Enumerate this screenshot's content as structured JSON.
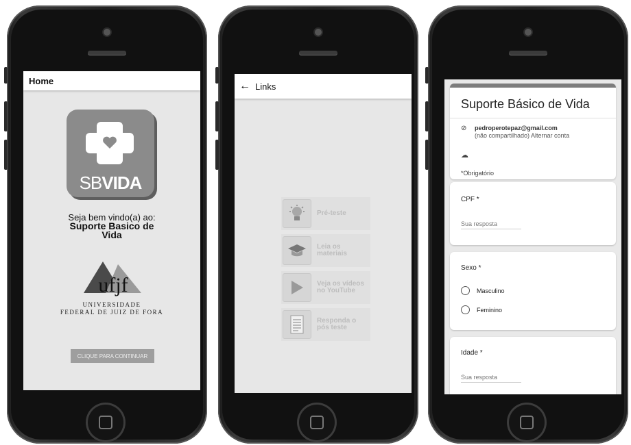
{
  "screen1": {
    "title": "Home",
    "logo": {
      "text_light": "SB",
      "text_bold": "VIDA"
    },
    "welcome_line1": "Seja bem vindo(a) ao:",
    "welcome_line2": "Suporte Basico de",
    "welcome_line3": "Vida",
    "ufjf": {
      "mark": "ufjf",
      "line1": "Universidade",
      "line2": "Federal de Juiz de Fora"
    },
    "continue_label": "CLIQUE PARA CONTINUAR"
  },
  "screen2": {
    "back_icon": "arrow-left-icon",
    "title": "Links",
    "tiles": [
      {
        "label_line1": "Pré-teste",
        "label_line2": "",
        "icon": "lightbulb-icon"
      },
      {
        "label_line1": "Leia os",
        "label_line2": "materiais",
        "icon": "graduation-cap-icon"
      },
      {
        "label_line1": "Veja os vídeos",
        "label_line2": "no YouTube",
        "icon": "play-icon"
      },
      {
        "label_line1": "Responda o",
        "label_line2": "pós teste",
        "icon": "document-icon"
      }
    ]
  },
  "screen3": {
    "form_title": "Suporte Básico de Vida",
    "email": "pedroperotepaz@gmail.com",
    "email_note": "(não compartilhado) Alternar conta",
    "required_note": "*Obrigatório",
    "questions": {
      "cpf_label": "CPF *",
      "cpf_placeholder": "Sua resposta",
      "sexo_label": "Sexo *",
      "sexo_options": [
        "Masculino",
        "Feminino"
      ],
      "idade_label": "Idade *",
      "idade_placeholder": "Sua resposta"
    }
  },
  "colors": {
    "screen_bg": "#e7e7e7",
    "logo_gray": "#8b8b8b",
    "button_gray": "#9e9e9e"
  }
}
